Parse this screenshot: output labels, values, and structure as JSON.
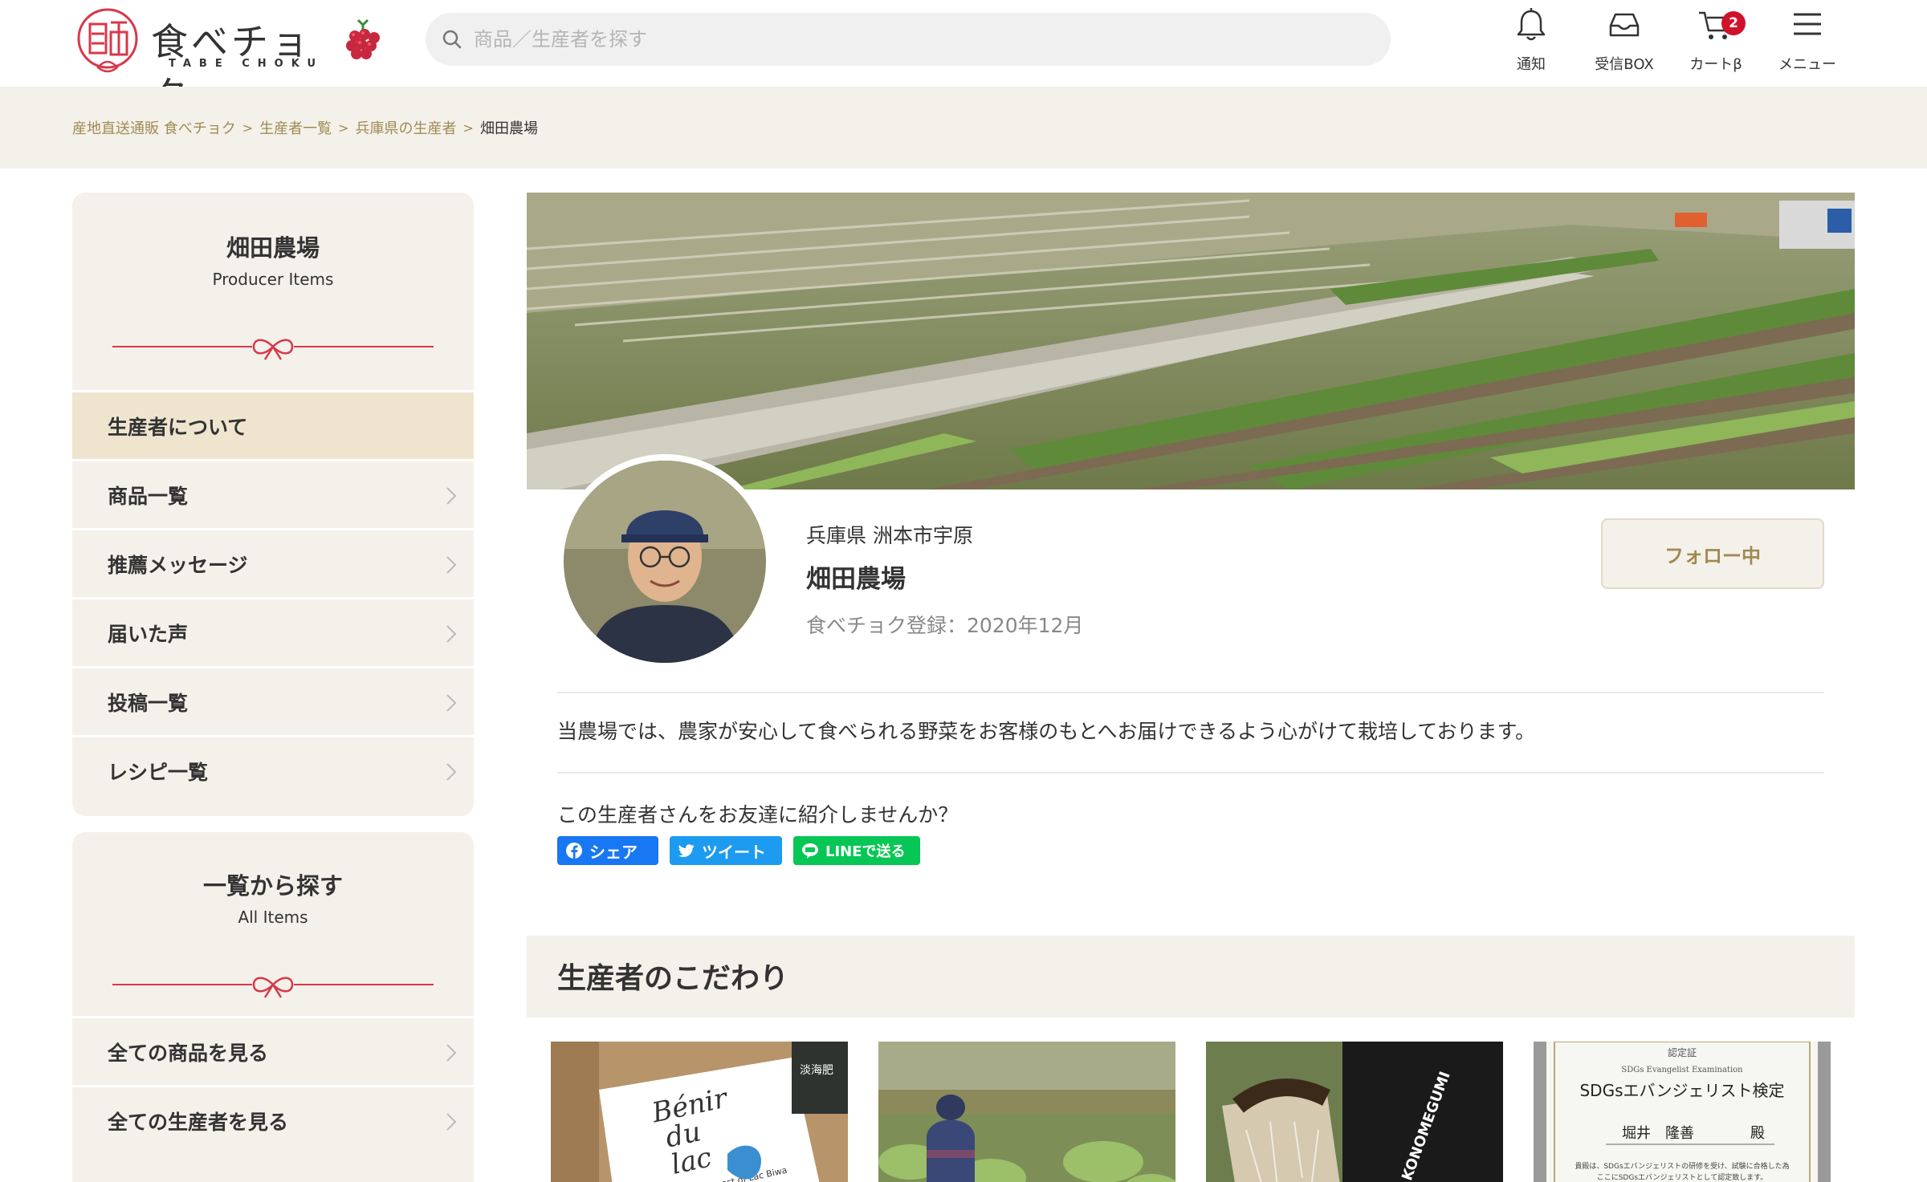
{
  "header": {
    "logo_jp": "食べチョク",
    "logo_en": "TABE CHOKU",
    "search_placeholder": "商品／生産者を探す",
    "nav": [
      {
        "icon": "bell-icon",
        "label": "通知"
      },
      {
        "icon": "inbox-icon",
        "label": "受信BOX"
      },
      {
        "icon": "cart-icon",
        "label": "カートβ",
        "badge": "2"
      },
      {
        "icon": "menu-icon",
        "label": "メニュー"
      }
    ]
  },
  "breadcrumb": {
    "items": [
      "産地直送通販 食べチョク",
      "生産者一覧",
      "兵庫県の生産者"
    ],
    "current": "畑田農場"
  },
  "sidebar": {
    "producer": {
      "title": "畑田農場",
      "subtitle": "Producer Items",
      "items": [
        {
          "label": "生産者について",
          "active": true
        },
        {
          "label": "商品一覧"
        },
        {
          "label": "推薦メッセージ"
        },
        {
          "label": "届いた声"
        },
        {
          "label": "投稿一覧"
        },
        {
          "label": "レシピ一覧"
        }
      ]
    },
    "browse": {
      "title": "一覧から探す",
      "subtitle": "All Items",
      "items": [
        {
          "label": "全ての商品を見る"
        },
        {
          "label": "全ての生産者を見る"
        }
      ]
    }
  },
  "profile": {
    "location": "兵庫県 洲本市宇原",
    "name": "畑田農場",
    "registered": "食べチョク登録：2020年12月",
    "follow_label": "フォロー中",
    "intro": "当農場では、農家が安心して食べられる野菜をお客様のもとへお届けできるよう心がけて栽培しております。",
    "share_question": "この生産者さんをお友達に紹介しませんか？",
    "share": {
      "facebook": "シェア",
      "twitter": "ツイート",
      "line": "LINEで送る"
    }
  },
  "section": {
    "title": "生産者のこだわり"
  },
  "thumbs": {
    "bag_text_1": "Bénir",
    "bag_text_2": "du",
    "bag_text_3": "lac",
    "bag_sub": "Waterweed compost of Lac Biwa",
    "bag_label": "淡海肥",
    "product2": "KONOMEGUMI",
    "cert_head": "認定証",
    "cert_sub": "SDGs Evangelist Examination",
    "cert_title": "SDGsエバンジェリスト検定",
    "cert_name": "堀井　隆善",
    "cert_honor": "殿",
    "cert_body_1": "貴殿は、SDGsエバンジェリストの研修を受け、試験に合格した為",
    "cert_body_2": "ここにSDGsエバンジェリストとして認定致します。"
  },
  "colors": {
    "accent_gold": "#a08a53",
    "band_beige": "#f4f1ea",
    "badge_red": "#d0112b",
    "ribbon_red": "#d8384a"
  }
}
